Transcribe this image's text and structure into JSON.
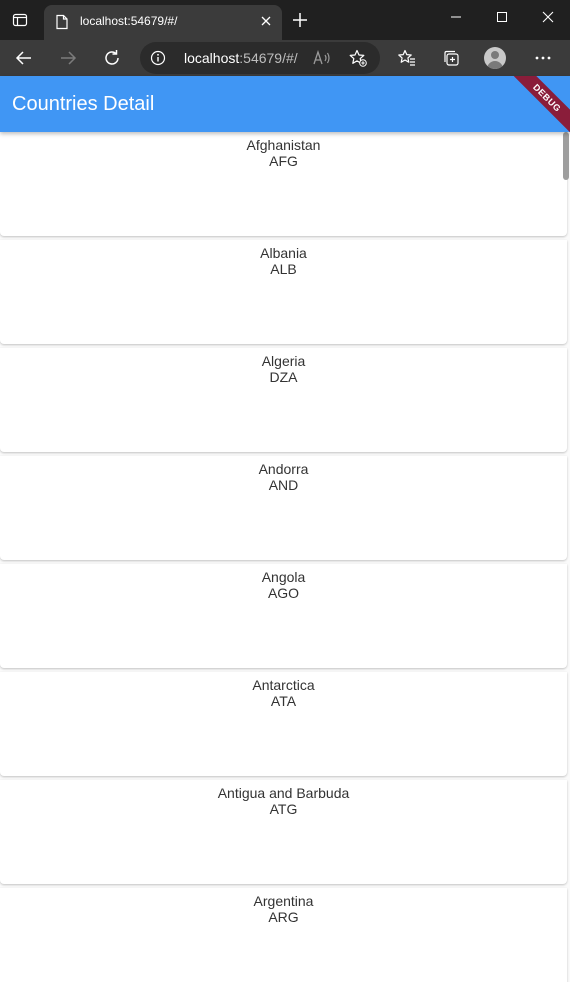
{
  "browser": {
    "tab": {
      "title": "localhost:54679/#/"
    },
    "address_bar": {
      "host": "localhost",
      "rest": ":54679/#/"
    }
  },
  "app": {
    "title": "Countries Detail",
    "debug_banner": "DEBUG",
    "primary_color": "#4096f4"
  },
  "countries": [
    {
      "name": "Afghanistan",
      "code": "AFG"
    },
    {
      "name": "Albania",
      "code": "ALB"
    },
    {
      "name": "Algeria",
      "code": "DZA"
    },
    {
      "name": "Andorra",
      "code": "AND"
    },
    {
      "name": "Angola",
      "code": "AGO"
    },
    {
      "name": "Antarctica",
      "code": "ATA"
    },
    {
      "name": "Antigua and Barbuda",
      "code": "ATG"
    },
    {
      "name": "Argentina",
      "code": "ARG"
    }
  ],
  "icons": {
    "tab_actions": "tab-actions-icon",
    "favicon": "page-icon",
    "close_tab": "close-icon",
    "new_tab": "plus-icon",
    "back": "arrow-left-icon",
    "forward": "arrow-right-icon",
    "reload": "reload-icon",
    "site_info": "info-icon",
    "read_aloud": "read-aloud-icon",
    "add_favorite": "star-add-icon",
    "favorites": "favorites-icon",
    "collections": "collections-icon",
    "profile": "avatar",
    "more": "more-icon"
  }
}
